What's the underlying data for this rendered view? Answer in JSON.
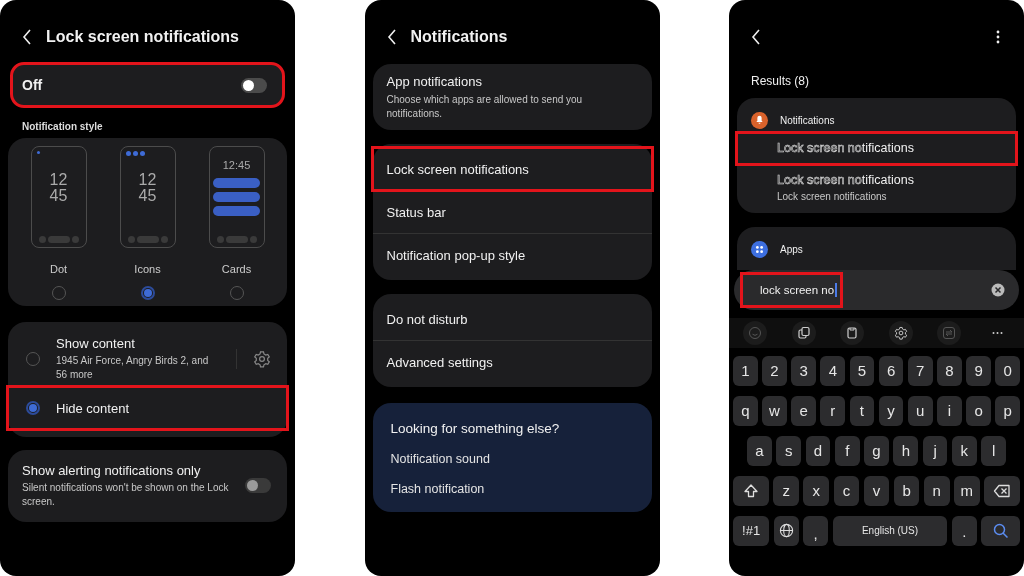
{
  "lock_screen_settings": {
    "title": "Lock screen notifications",
    "master": {
      "label": "Off",
      "on": false,
      "highlighted": true
    },
    "style_heading": "Notification style",
    "styles": [
      {
        "kind": "dot",
        "label": "Dot",
        "clock": [
          "12",
          "45"
        ],
        "selected": false
      },
      {
        "kind": "icons",
        "label": "Icons",
        "clock": [
          "12",
          "45"
        ],
        "selected": true
      },
      {
        "kind": "cards",
        "label": "Cards",
        "clock": [
          "12:45"
        ],
        "selected": false
      }
    ],
    "content_options": [
      {
        "title": "Show content",
        "subtitle": "1945 Air Force, Angry Birds 2, and 56 more",
        "settings": true,
        "selected": false,
        "highlighted": false
      },
      {
        "title": "Hide content",
        "settings": false,
        "selected": true,
        "highlighted": true
      }
    ],
    "alerting": {
      "title": "Show alerting notifications only",
      "subtitle": "Silent notifications won't be shown on the Lock screen.",
      "on": false,
      "disabled": true
    }
  },
  "notifications_settings": {
    "title": "Notifications",
    "groups": [
      {
        "items": [
          {
            "title": "App notifications",
            "subtitle": "Choose which apps are allowed to send you notifications.",
            "highlighted": false
          }
        ]
      },
      {
        "items": [
          {
            "title": "Lock screen notifications",
            "highlighted": true
          },
          {
            "title": "Status bar",
            "highlighted": false
          },
          {
            "title": "Notification pop-up style",
            "highlighted": false
          }
        ]
      },
      {
        "items": [
          {
            "title": "Do not disturb",
            "highlighted": false
          },
          {
            "title": "Advanced settings",
            "highlighted": false
          }
        ]
      }
    ],
    "suggestions": {
      "title": "Looking for something else?",
      "links": [
        "Notification sound",
        "Flash notification"
      ]
    }
  },
  "search": {
    "results_label": "Results (8)",
    "sections": [
      {
        "kind": "notifications",
        "title": "Notifications",
        "color": "#d9622b",
        "results": [
          {
            "match": "Lock screen no",
            "rest": "tifications",
            "highlighted": true
          },
          {
            "match": "Lock screen no",
            "rest": "tifications",
            "subtitle": "Lock screen notifications",
            "highlighted": false
          }
        ]
      },
      {
        "kind": "apps",
        "title": "Apps",
        "color": "#3d6fe0"
      }
    ],
    "query": {
      "value": "lock screen no",
      "highlighted": true
    },
    "keyboard": {
      "toolbar": [
        {
          "kind": "emoji",
          "disabled": true
        },
        {
          "kind": "translate",
          "disabled": false
        },
        {
          "kind": "clipboard",
          "disabled": false
        },
        {
          "kind": "settings",
          "disabled": false
        },
        {
          "kind": "swap",
          "disabled": true
        },
        {
          "kind": "more",
          "disabled": false
        }
      ],
      "rows": [
        {
          "keys": [
            "1",
            "2",
            "3",
            "4",
            "5",
            "6",
            "7",
            "8",
            "9",
            "0"
          ]
        },
        {
          "keys": [
            "q",
            "w",
            "e",
            "r",
            "t",
            "y",
            "u",
            "i",
            "o",
            "p"
          ]
        },
        {
          "keys": [
            "a",
            "s",
            "d",
            "f",
            "g",
            "h",
            "j",
            "k",
            "l"
          ]
        },
        {
          "keys": [
            {
              "kind": "shift"
            },
            "z",
            "x",
            "c",
            "v",
            "b",
            "n",
            "m",
            {
              "kind": "backspace"
            }
          ]
        },
        {
          "keys": [
            {
              "kind": "symbols",
              "label": "!#1"
            },
            {
              "kind": "globe"
            },
            {
              "kind": "comma",
              "label": ","
            },
            {
              "kind": "space",
              "label": "English (US)"
            },
            {
              "kind": "period",
              "label": "."
            },
            {
              "kind": "search"
            }
          ]
        }
      ]
    }
  }
}
